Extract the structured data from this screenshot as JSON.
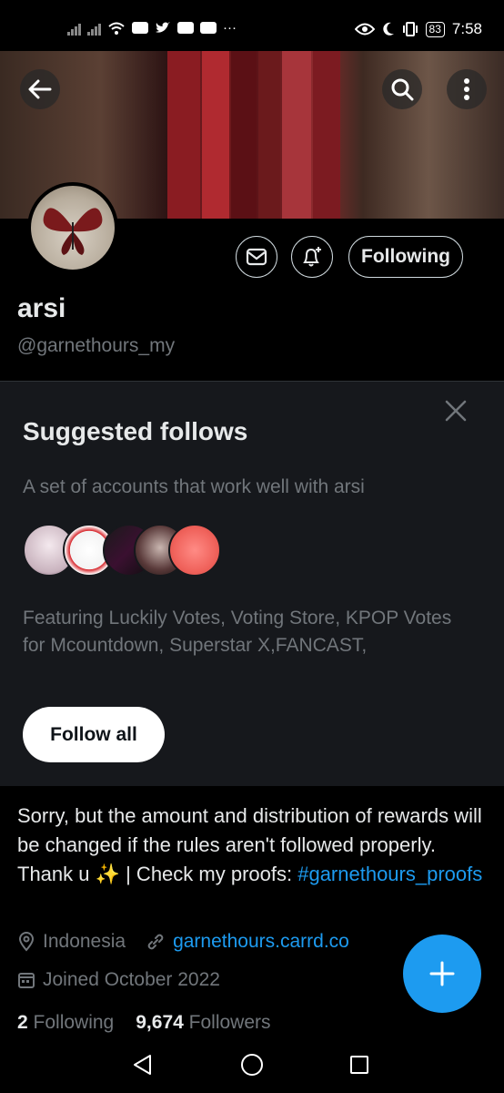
{
  "status_bar": {
    "time": "7:58",
    "battery": "83",
    "icons": [
      "signal-icon",
      "wifi-icon",
      "youtube-icon",
      "twitter-icon",
      "eye-icon",
      "moon-icon",
      "vibrate-icon",
      "battery-icon"
    ],
    "more": "···"
  },
  "header": {
    "back_icon": "arrow-left-icon",
    "search_icon": "search-icon",
    "more_icon": "more-vertical-icon"
  },
  "profile": {
    "name": "arsi",
    "handle": "@garnethours_my",
    "follow_state": "Following",
    "message_icon": "envelope-icon",
    "notify_icon": "bell-plus-icon"
  },
  "suggested": {
    "title": "Suggested follows",
    "subtitle": "A set of accounts that work well with arsi",
    "featuring": "Featuring Luckily Votes, Voting Store, KPOP Votes for Mcountdown, Superstar X,FANCAST,",
    "follow_all": "Follow all",
    "close_icon": "close-icon"
  },
  "bio": {
    "text": "Sorry, but the amount and distribution of rewards will be changed if the rules aren't followed properly. Thank u ✨ | Check my proofs: ",
    "hashtag": "#garnethours_proofs",
    "location": "Indonesia",
    "website": "garnethours.carrd.co",
    "joined": "Joined October 2022"
  },
  "stats": {
    "following_count": "2",
    "following_label": "Following",
    "followers_count": "9,674",
    "followers_label": "Followers"
  },
  "fab": {
    "icon": "plus-icon"
  },
  "colors": {
    "accent": "#1d9bf0",
    "background": "#000000",
    "panel": "#16181c",
    "muted": "#71767b"
  }
}
